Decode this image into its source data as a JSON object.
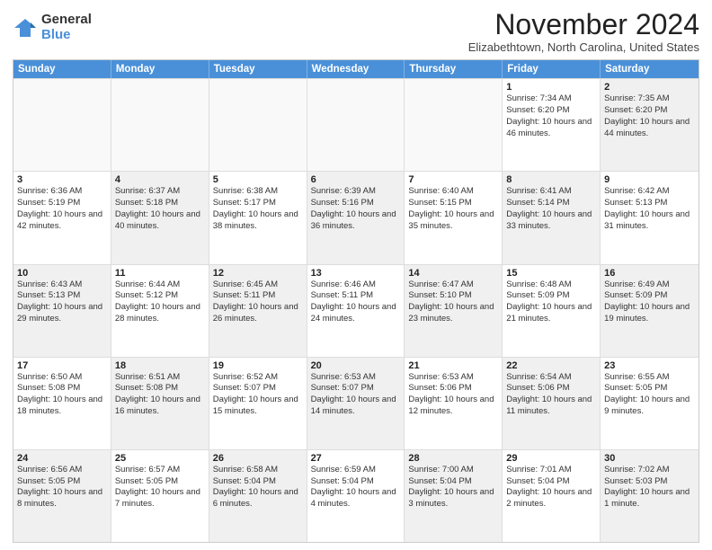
{
  "logo": {
    "general": "General",
    "blue": "Blue"
  },
  "header": {
    "month": "November 2024",
    "location": "Elizabethtown, North Carolina, United States"
  },
  "weekdays": [
    "Sunday",
    "Monday",
    "Tuesday",
    "Wednesday",
    "Thursday",
    "Friday",
    "Saturday"
  ],
  "rows": [
    [
      {
        "day": "",
        "info": "",
        "empty": true
      },
      {
        "day": "",
        "info": "",
        "empty": true
      },
      {
        "day": "",
        "info": "",
        "empty": true
      },
      {
        "day": "",
        "info": "",
        "empty": true
      },
      {
        "day": "",
        "info": "",
        "empty": true
      },
      {
        "day": "1",
        "info": "Sunrise: 7:34 AM\nSunset: 6:20 PM\nDaylight: 10 hours and 46 minutes."
      },
      {
        "day": "2",
        "info": "Sunrise: 7:35 AM\nSunset: 6:20 PM\nDaylight: 10 hours and 44 minutes.",
        "shaded": true
      }
    ],
    [
      {
        "day": "3",
        "info": "Sunrise: 6:36 AM\nSunset: 5:19 PM\nDaylight: 10 hours and 42 minutes."
      },
      {
        "day": "4",
        "info": "Sunrise: 6:37 AM\nSunset: 5:18 PM\nDaylight: 10 hours and 40 minutes.",
        "shaded": true
      },
      {
        "day": "5",
        "info": "Sunrise: 6:38 AM\nSunset: 5:17 PM\nDaylight: 10 hours and 38 minutes."
      },
      {
        "day": "6",
        "info": "Sunrise: 6:39 AM\nSunset: 5:16 PM\nDaylight: 10 hours and 36 minutes.",
        "shaded": true
      },
      {
        "day": "7",
        "info": "Sunrise: 6:40 AM\nSunset: 5:15 PM\nDaylight: 10 hours and 35 minutes."
      },
      {
        "day": "8",
        "info": "Sunrise: 6:41 AM\nSunset: 5:14 PM\nDaylight: 10 hours and 33 minutes.",
        "shaded": true
      },
      {
        "day": "9",
        "info": "Sunrise: 6:42 AM\nSunset: 5:13 PM\nDaylight: 10 hours and 31 minutes."
      }
    ],
    [
      {
        "day": "10",
        "info": "Sunrise: 6:43 AM\nSunset: 5:13 PM\nDaylight: 10 hours and 29 minutes.",
        "shaded": true
      },
      {
        "day": "11",
        "info": "Sunrise: 6:44 AM\nSunset: 5:12 PM\nDaylight: 10 hours and 28 minutes."
      },
      {
        "day": "12",
        "info": "Sunrise: 6:45 AM\nSunset: 5:11 PM\nDaylight: 10 hours and 26 minutes.",
        "shaded": true
      },
      {
        "day": "13",
        "info": "Sunrise: 6:46 AM\nSunset: 5:11 PM\nDaylight: 10 hours and 24 minutes."
      },
      {
        "day": "14",
        "info": "Sunrise: 6:47 AM\nSunset: 5:10 PM\nDaylight: 10 hours and 23 minutes.",
        "shaded": true
      },
      {
        "day": "15",
        "info": "Sunrise: 6:48 AM\nSunset: 5:09 PM\nDaylight: 10 hours and 21 minutes."
      },
      {
        "day": "16",
        "info": "Sunrise: 6:49 AM\nSunset: 5:09 PM\nDaylight: 10 hours and 19 minutes.",
        "shaded": true
      }
    ],
    [
      {
        "day": "17",
        "info": "Sunrise: 6:50 AM\nSunset: 5:08 PM\nDaylight: 10 hours and 18 minutes."
      },
      {
        "day": "18",
        "info": "Sunrise: 6:51 AM\nSunset: 5:08 PM\nDaylight: 10 hours and 16 minutes.",
        "shaded": true
      },
      {
        "day": "19",
        "info": "Sunrise: 6:52 AM\nSunset: 5:07 PM\nDaylight: 10 hours and 15 minutes."
      },
      {
        "day": "20",
        "info": "Sunrise: 6:53 AM\nSunset: 5:07 PM\nDaylight: 10 hours and 14 minutes.",
        "shaded": true
      },
      {
        "day": "21",
        "info": "Sunrise: 6:53 AM\nSunset: 5:06 PM\nDaylight: 10 hours and 12 minutes."
      },
      {
        "day": "22",
        "info": "Sunrise: 6:54 AM\nSunset: 5:06 PM\nDaylight: 10 hours and 11 minutes.",
        "shaded": true
      },
      {
        "day": "23",
        "info": "Sunrise: 6:55 AM\nSunset: 5:05 PM\nDaylight: 10 hours and 9 minutes."
      }
    ],
    [
      {
        "day": "24",
        "info": "Sunrise: 6:56 AM\nSunset: 5:05 PM\nDaylight: 10 hours and 8 minutes.",
        "shaded": true
      },
      {
        "day": "25",
        "info": "Sunrise: 6:57 AM\nSunset: 5:05 PM\nDaylight: 10 hours and 7 minutes."
      },
      {
        "day": "26",
        "info": "Sunrise: 6:58 AM\nSunset: 5:04 PM\nDaylight: 10 hours and 6 minutes.",
        "shaded": true
      },
      {
        "day": "27",
        "info": "Sunrise: 6:59 AM\nSunset: 5:04 PM\nDaylight: 10 hours and 4 minutes."
      },
      {
        "day": "28",
        "info": "Sunrise: 7:00 AM\nSunset: 5:04 PM\nDaylight: 10 hours and 3 minutes.",
        "shaded": true
      },
      {
        "day": "29",
        "info": "Sunrise: 7:01 AM\nSunset: 5:04 PM\nDaylight: 10 hours and 2 minutes."
      },
      {
        "day": "30",
        "info": "Sunrise: 7:02 AM\nSunset: 5:03 PM\nDaylight: 10 hours and 1 minute.",
        "shaded": true
      }
    ]
  ]
}
